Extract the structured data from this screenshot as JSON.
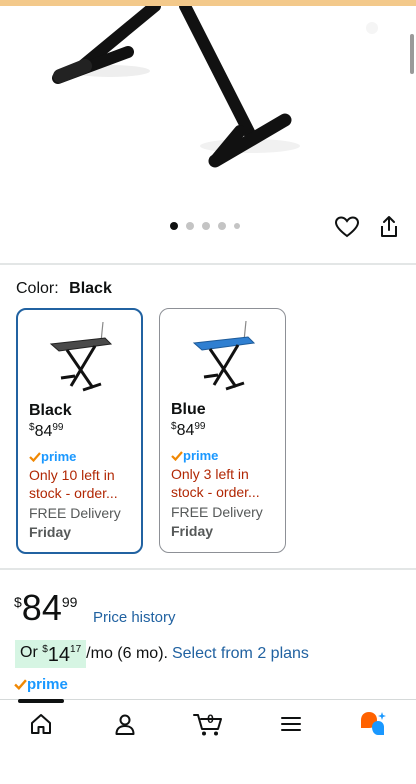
{
  "product": {
    "image_dots": {
      "count": 5,
      "active": 0
    },
    "actions": {
      "wishlist_icon": "heart-icon",
      "share_icon": "share-icon"
    }
  },
  "color": {
    "label": "Color:",
    "selected": "Black"
  },
  "swatches": [
    {
      "name": "Black",
      "price_symbol": "$",
      "price_whole": "84",
      "price_fraction": "99",
      "prime": "prime",
      "stock_line1": "Only 10 left in",
      "stock_line2": "stock - order...",
      "delivery": "FREE Delivery",
      "day": "Friday",
      "board_color": "#4a4a4a"
    },
    {
      "name": "Blue",
      "price_symbol": "$",
      "price_whole": "84",
      "price_fraction": "99",
      "prime": "prime",
      "stock_line1": "Only 3 left in",
      "stock_line2": "stock - order...",
      "delivery": "FREE Delivery",
      "day": "Friday",
      "board_color": "#2f7fd1"
    }
  ],
  "pricing": {
    "symbol": "$",
    "whole": "84",
    "fraction": "99",
    "history_link": "Price history",
    "installment_prefix": "Or",
    "installment_symbol": "$",
    "installment_whole": "14",
    "installment_fraction": "17",
    "installment_suffix": "/mo (6 mo).",
    "installment_link": "Select from 2 plans",
    "prime": "prime"
  },
  "bottom_nav": {
    "cart_count": "0",
    "items": [
      "home-icon",
      "account-icon",
      "cart-icon",
      "menu-icon",
      "rufus-icon"
    ]
  },
  "colors": {
    "link": "#2162a1",
    "stock_warning": "#b12704",
    "prime_blue": "#1a98ff",
    "prime_check": "#f08804",
    "selected_border": "#2162a1",
    "installment_bg": "#d6f5e3",
    "rufus_orange": "#ff6200",
    "rufus_blue": "#1a98ff"
  }
}
